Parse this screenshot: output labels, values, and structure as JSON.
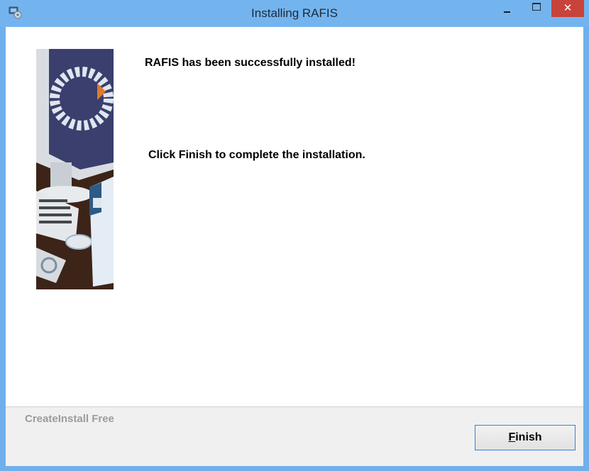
{
  "window": {
    "title": "Installing RAFIS",
    "icon": "installer-app-icon",
    "controls": {
      "minimize": "minimize-icon",
      "maximize": "maximize-icon",
      "close": "close-icon",
      "close_glyph": "✕"
    },
    "colors": {
      "titlebar": "#73b4ef",
      "close": "#c8433a",
      "border": "#6fb0ec"
    }
  },
  "main": {
    "heading": "RAFIS has been successfully installed!",
    "instruction": "Click Finish to complete the installation.",
    "sidebar_image": "rafis-product-illustration"
  },
  "footer": {
    "brand": "CreateInstall Free",
    "finish_label": "Finish"
  }
}
